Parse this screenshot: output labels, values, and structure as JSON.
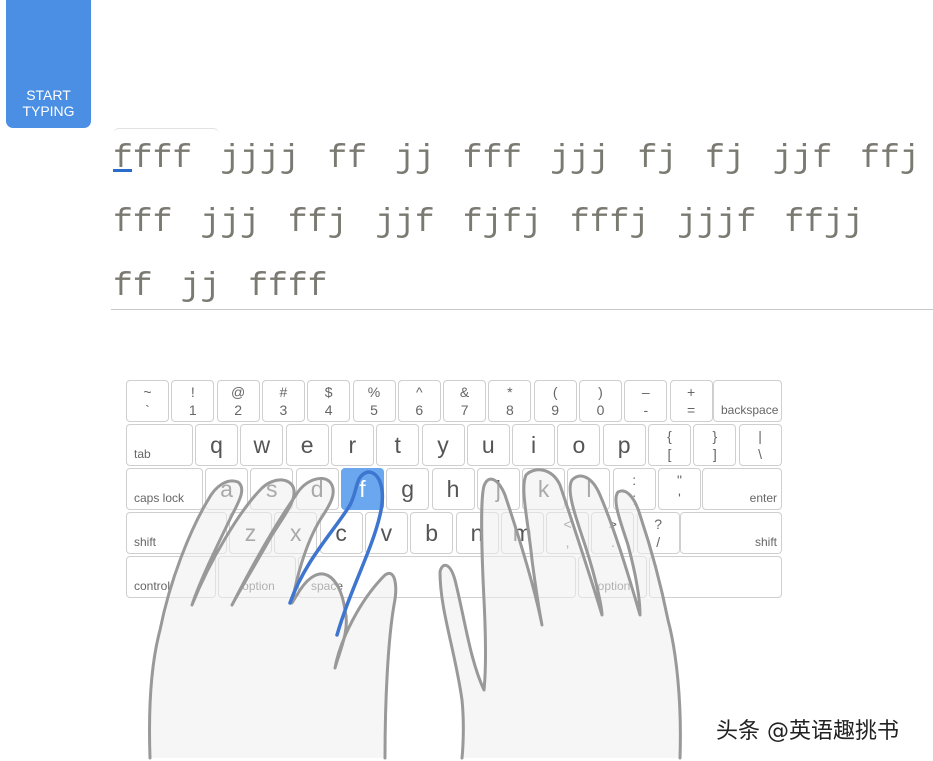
{
  "start_button": {
    "label_1": "START",
    "label_2": "TYPING",
    "color": "#4a8fe3"
  },
  "lesson": {
    "lines": [
      [
        "ffff",
        "jjjj",
        "ff",
        "jj",
        "fff",
        "jjj",
        "fj",
        "fj",
        "jjf",
        "ffj"
      ],
      [
        "fff",
        "jjj",
        "ffj",
        "jjf",
        "fjfj",
        "fffj",
        "jjjf",
        "ffjj"
      ],
      [
        "ff",
        "jj",
        "ffff"
      ]
    ],
    "current_word_index": 0,
    "current_char_index": 0
  },
  "keyboard": {
    "highlighted_key": "f",
    "highlight_color": "#6aa7ee",
    "row1": [
      [
        "~",
        "`"
      ],
      [
        "!",
        "1"
      ],
      [
        "@",
        "2"
      ],
      [
        "#",
        "3"
      ],
      [
        "$",
        "4"
      ],
      [
        "%",
        "5"
      ],
      [
        "^",
        "6"
      ],
      [
        "&",
        "7"
      ],
      [
        "*",
        "8"
      ],
      [
        "(",
        "9"
      ],
      [
        ")",
        "0"
      ],
      [
        "–",
        "-"
      ],
      [
        "+",
        "="
      ]
    ],
    "backspace": "backspace",
    "tab": "tab",
    "row2": [
      "q",
      "w",
      "e",
      "r",
      "t",
      "y",
      "u",
      "i",
      "o",
      "p"
    ],
    "row2_sym": [
      [
        "{",
        "["
      ],
      [
        "}",
        "]"
      ],
      [
        "|",
        "\\"
      ]
    ],
    "caps_lock": "caps lock",
    "row3": [
      "a",
      "s",
      "d",
      "f",
      "g",
      "h",
      "j",
      "k",
      "l"
    ],
    "row3_sym": [
      [
        ":",
        ";"
      ],
      [
        "\"",
        "'"
      ]
    ],
    "enter": "enter",
    "shift_left": "shift",
    "row4": [
      "z",
      "x",
      "c",
      "v",
      "b",
      "n",
      "m"
    ],
    "row4_sym": [
      [
        "<",
        ","
      ],
      [
        ">",
        "."
      ],
      [
        "?",
        "/"
      ]
    ],
    "shift_right": "shift",
    "control": "control",
    "option_left": "option",
    "space": "space",
    "option_right": "option"
  },
  "watermark": "头条 @英语趣挑书"
}
